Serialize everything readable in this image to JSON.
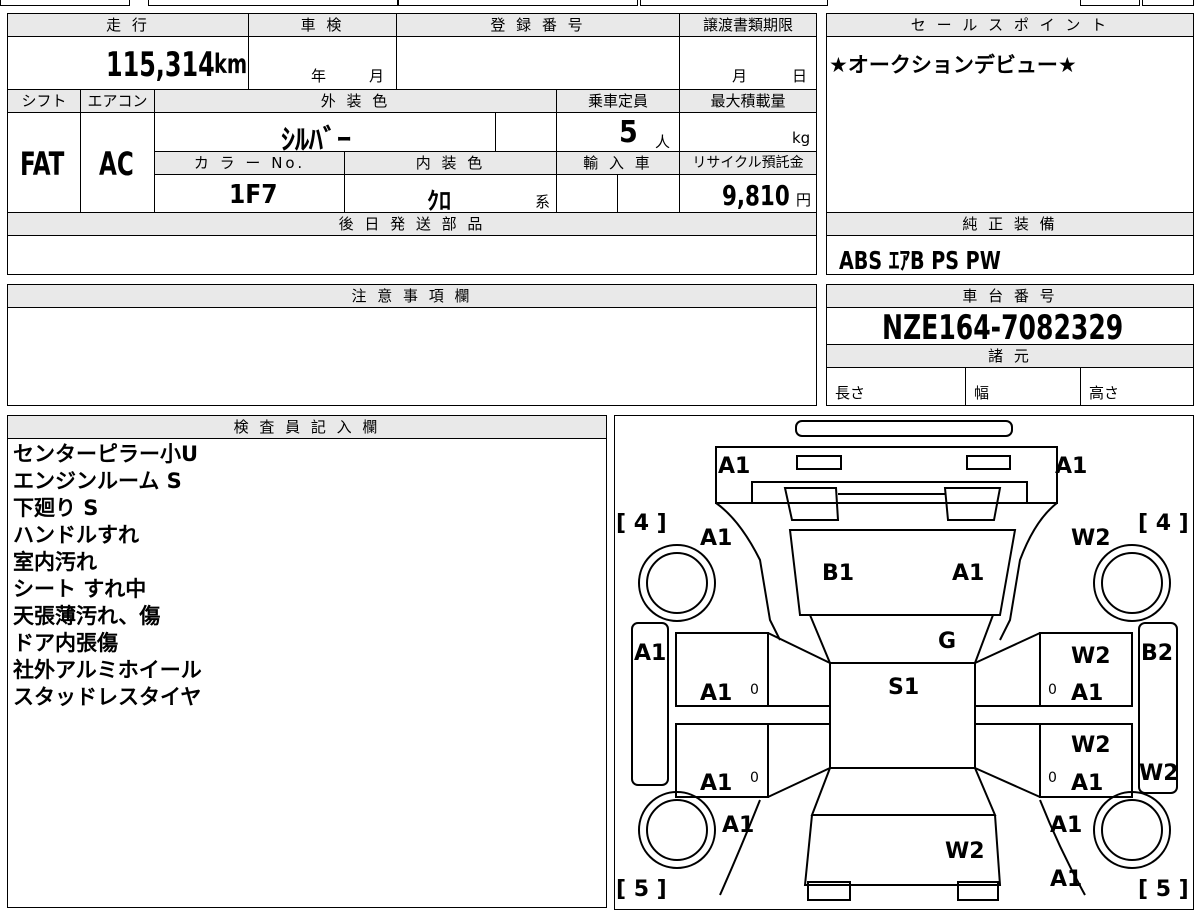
{
  "sheet": {
    "mileage": {
      "label": "走 行",
      "value": "115,314",
      "unit": "km"
    },
    "inspection": {
      "label": "車 検",
      "year_unit": "年",
      "month_unit": "月"
    },
    "registration": {
      "label": "登 録 番 号"
    },
    "transfer_deadline": {
      "label": "譲渡書類期限",
      "month_unit": "月",
      "day_unit": "日"
    },
    "shift": {
      "label": "シフト",
      "value": "FAT"
    },
    "aircon": {
      "label": "エアコン",
      "value": "AC"
    },
    "exterior_color": {
      "label": "外 装 色",
      "value": "ｼﾙﾊﾞｰ"
    },
    "capacity": {
      "label": "乗車定員",
      "value": "5",
      "unit": "人"
    },
    "max_load": {
      "label": "最大積載量",
      "unit": "kg"
    },
    "color_no": {
      "label": "カ ラ ー No.",
      "value": "1F7"
    },
    "interior_color": {
      "label": "内 装 色",
      "value": "ｸﾛ",
      "unit": "系"
    },
    "import": {
      "label": "輸 入 車"
    },
    "recycle_fee": {
      "label": "リサイクル預託金",
      "value": "9,810",
      "unit": "円"
    },
    "later_parts": {
      "label": "後 日 発 送 部 品"
    },
    "notes_section": {
      "label": "注 意 事 項 欄"
    },
    "sales_point": {
      "label": "セ ー ル ス ポ イ ン ト",
      "text": "★オークションデビュー★"
    },
    "genuine_equipment": {
      "label": "純 正 装 備",
      "value": "ABS ｴｱB PS PW"
    },
    "chassis_number": {
      "label": "車 台 番 号",
      "value": "NZE164-7082329"
    },
    "specs": {
      "label": "諸 元",
      "length": "長さ",
      "width": "幅",
      "height": "高さ"
    },
    "inspector": {
      "label": "検 査 員 記 入 欄",
      "lines": [
        "センターピラー小U",
        "エンジンルーム S",
        "下廻り S",
        "ハンドルすれ",
        "室内汚れ",
        "シート すれ中",
        "天張薄汚れ、傷",
        "ドア内張傷",
        "社外アルミホイール",
        "スタッドレスタイヤ"
      ]
    },
    "diagram": {
      "tire_front_left": "[ 4 ]",
      "tire_front_right": "[ 4 ]",
      "tire_rear_left": "[ 5 ]",
      "tire_rear_right": "[ 5 ]",
      "marks": [
        "A1",
        "A1",
        "A1",
        "W2",
        "B1",
        "A1",
        "G",
        "A1",
        "W2",
        "B2",
        "A1",
        "S1",
        "A1",
        "W2",
        "A1",
        "A1",
        "W2",
        "A1",
        "A1",
        "W2",
        "A1",
        "A1"
      ],
      "zero_marks": [
        "0",
        "0",
        "0",
        "0"
      ]
    }
  }
}
